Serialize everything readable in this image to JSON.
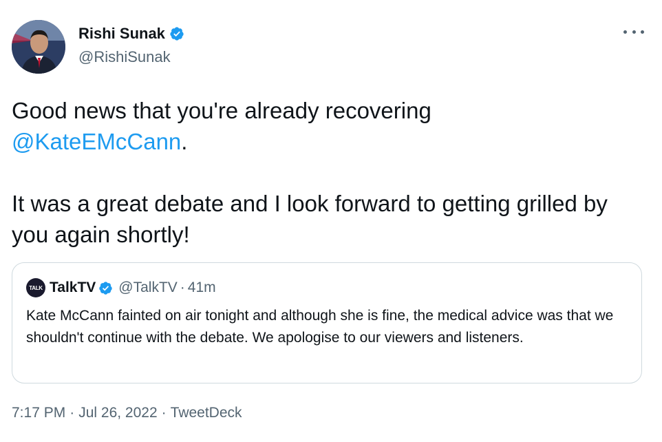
{
  "author": {
    "name": "Rishi Sunak",
    "handle": "@RishiSunak",
    "verified": true
  },
  "tweet": {
    "line1_text": "Good news that you're already recovering",
    "mention": "@KateEMcCann",
    "mention_suffix": ".",
    "paragraph2": "It was a great debate and I look forward to getting grilled by you again shortly!"
  },
  "quoted_tweet": {
    "avatar_label": "TALK",
    "name": "TalkTV",
    "verified": true,
    "handle": "@TalkTV",
    "separator": "·",
    "time": "41m",
    "text": "Kate McCann fainted on air tonight and although she is fine, the medical advice was that we shouldn't continue with the debate. We apologise to our viewers and listeners."
  },
  "meta": {
    "time": "7:17 PM",
    "separator": "·",
    "date": "Jul 26, 2022",
    "source": "TweetDeck"
  },
  "icons": {
    "verified": "verified-badge-icon",
    "more": "more-options-icon"
  },
  "colors": {
    "accent": "#1d9bf0",
    "text": "#0f1419",
    "secondary": "#536471",
    "border": "#cfd9de"
  }
}
